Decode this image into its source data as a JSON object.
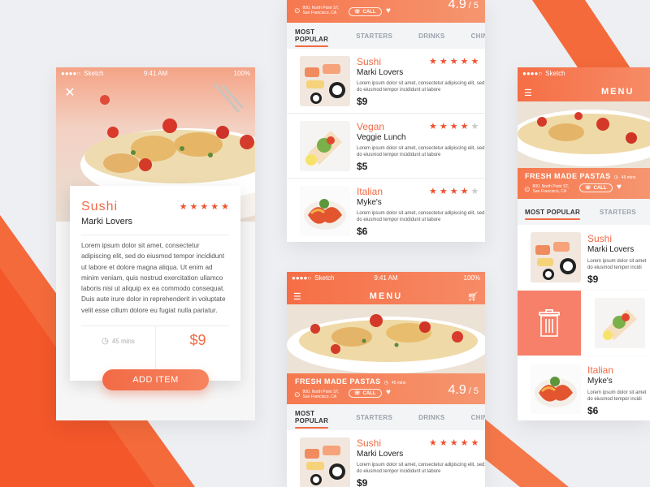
{
  "colors": {
    "accent": "#f26a45",
    "accent_light": "#f7967a",
    "bg": "#eeeff2"
  },
  "status": {
    "carrier": "Sketch",
    "time": "9:41 AM",
    "battery": "100%"
  },
  "detail": {
    "category": "Sushi",
    "dish": "Marki Lovers",
    "rating": 5,
    "description": "Lorem ipsum dolor sit amet, consectetur adipiscing elit, sed do eiusmod tempor incididunt ut labore et dolore magna aliqua. Ut enim ad minim veniam, quis nostrud exercitation ullamco laboris nisi ut aliquip ex ea commodo consequat. Duis aute irure dolor in reprehenderit in voluptate velit esse cillum dolore eu fugiat nulla pariatur.",
    "time": "45 mins",
    "price": "$9",
    "add_label": "ADD ITEM"
  },
  "restaurant": {
    "name": "FRESH MADE PASTAS",
    "time": "45 mins",
    "address1": "800, North Point ST,",
    "address2": "San Francisco, CA",
    "call_label": "CALL",
    "rating": "4.9",
    "rating_max": "/ 5"
  },
  "menu_title": "MENU",
  "tabs": [
    "MOST POPULAR",
    "STARTERS",
    "DRINKS",
    "CHINESE"
  ],
  "menu_items": [
    {
      "category": "Sushi",
      "dish": "Marki Lovers",
      "rating": 5,
      "desc1": "Lorem ipsum dolor sit amet, consectetur adipiscing elit, sed",
      "desc2": "do eiusmod tempor incididunt ut labore",
      "price": "$9"
    },
    {
      "category": "Vegan",
      "dish": "Veggie Lunch",
      "rating": 4,
      "desc1": "Lorem ipsum dolor sit amet, consectetur adipiscing elit, sed",
      "desc2": "do eiusmod tempor incididunt ut labore",
      "price": "$5"
    },
    {
      "category": "Italian",
      "dish": "Myke's",
      "rating": 4,
      "desc1": "Lorem ipsum dolor sit amet, consectetur adipiscing elit, sed",
      "desc2": "do eiusmod tempor incididunt ut labore",
      "price": "$6"
    }
  ],
  "right_items": [
    {
      "category": "Sushi",
      "dish": "Marki Lovers",
      "desc1": "Lorem ipsum dolor sit amet",
      "desc2": "do eiusmod tempor incidi",
      "price": "$9"
    },
    {
      "category": "Italian",
      "dish": "Myke's",
      "desc1": "Lorem ipsum dolor sit amet",
      "desc2": "do eiusmod tempor incidi",
      "price": "$6"
    }
  ]
}
